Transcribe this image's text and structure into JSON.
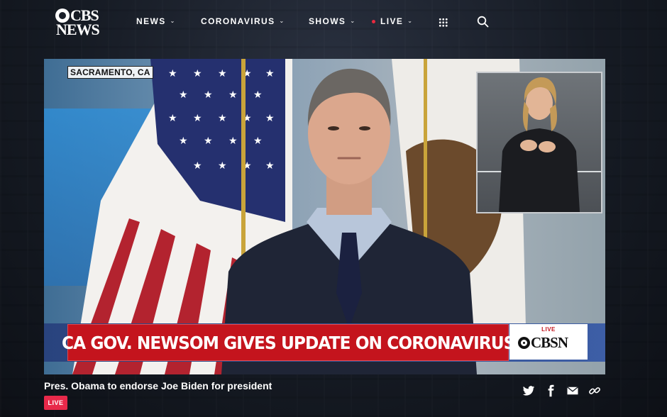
{
  "header": {
    "logo": {
      "line1": "CBS",
      "line2": "NEWS"
    },
    "nav": [
      {
        "label": "NEWS",
        "chevron": "⌄"
      },
      {
        "label": "CORONAVIRUS",
        "chevron": "⌄"
      },
      {
        "label": "SHOWS",
        "chevron": "⌄"
      },
      {
        "label": "LIVE",
        "chevron": "⌄"
      }
    ],
    "icons": {
      "apps": "grid-icon",
      "search": "search-icon"
    },
    "live_dot_color": "#e8293f"
  },
  "video": {
    "dateline": "SACRAMENTO, CA",
    "lower_third": "CA GOV. NEWSOM GIVES UPDATE ON CORONAVIRUS",
    "bug": {
      "live": "LIVE",
      "brand": "CBSN"
    }
  },
  "below": {
    "headline": "Pres. Obama to endorse Joe Biden for president",
    "live_badge": "LIVE",
    "share_icons": [
      "twitter-icon",
      "facebook-icon",
      "email-icon",
      "link-icon"
    ]
  },
  "colors": {
    "accent_red": "#e8294a",
    "ticker_red": "#c4141d"
  }
}
